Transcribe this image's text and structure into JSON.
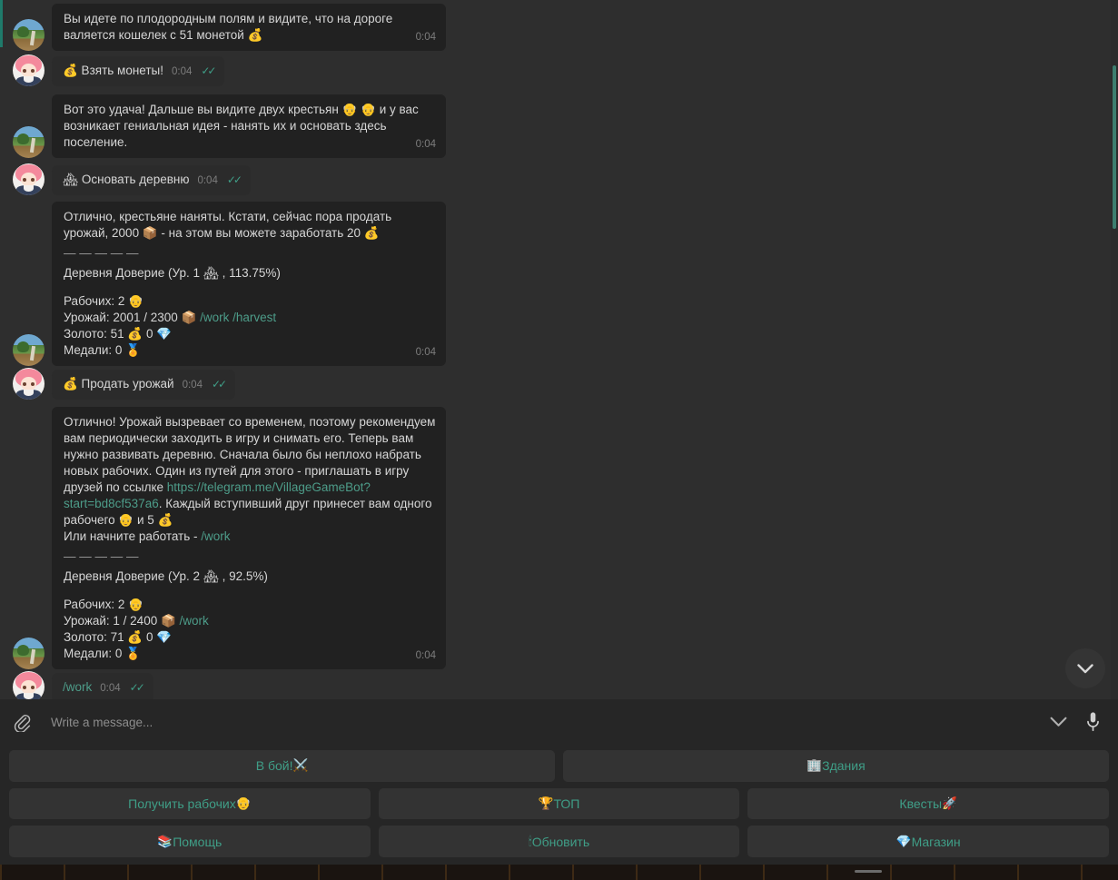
{
  "app": {
    "background_color": "#2e2e2e",
    "accent_color": "#3f9e87",
    "bubble_in_color": "#212121",
    "bubble_out_color": "#2b2b2b"
  },
  "messages": [
    {
      "id": "m1",
      "direction": "in",
      "text": "Вы идете по плодородным полям и видите, что на дороге валяется кошелек с 51 монетой 💰",
      "time": "0:04"
    },
    {
      "id": "m2",
      "direction": "out",
      "text": "💰 Взять монеты!",
      "time": "0:04",
      "status": "read"
    },
    {
      "id": "m3",
      "direction": "in",
      "text": "Вот это удача! Дальше вы видите двух крестьян 👴 👴 и у вас возникает гениальная идея - нанять их и основать здесь поселение.",
      "time": "0:04"
    },
    {
      "id": "m4",
      "direction": "out",
      "text": "🏘 Основать деревню",
      "time": "0:04",
      "status": "read"
    },
    {
      "id": "m5",
      "direction": "in",
      "time": "0:04",
      "intro": "Отлично, крестьяне наняты. Кстати, сейчас пора продать урожай, 2000  📦 - на этом вы можете заработать 20  💰",
      "separator": "—  —  —  —  —",
      "village_line": "Деревня Доверие  (Ур. 1 🏘 , 113.75%)",
      "stats": [
        {
          "label": "Рабочих: 2 ",
          "emoji": "👴",
          "links": ""
        },
        {
          "label": "Урожай: 2001 / 2300 ",
          "emoji": "📦",
          "links": "/work /harvest"
        },
        {
          "label": "Золото: 51 ",
          "emoji": "💰 0 💎",
          "links": ""
        },
        {
          "label": "Медали: 0 ",
          "emoji": "🏅",
          "links": ""
        }
      ]
    },
    {
      "id": "m6",
      "direction": "out",
      "text": "💰 Продать урожай",
      "time": "0:04",
      "status": "read"
    },
    {
      "id": "m7",
      "direction": "in",
      "time": "0:04",
      "intro_a": "Отлично! Урожай вызревает со временем, поэтому рекомендуем вам периодически заходить в игру и снимать его. Теперь вам нужно развивать деревню. Сначала было бы неплохо набрать новых рабочих. Один из путей для этого - приглашать в игру друзей по ссылке ",
      "invite_link": "https://telegram.me/VillageGameBot?start=bd8cf537a6",
      "intro_b": ". Каждый вступивший друг принесет вам одного рабочего 👴 и 5  💰",
      "work_prefix": "Или начните работать - ",
      "work_link": "/work",
      "separator": "—  —  —  —  —",
      "village_line": "Деревня Доверие  (Ур. 2 🏘 , 92.5%)",
      "stats": [
        {
          "label": "Рабочих: 2 ",
          "emoji": "👴",
          "links": ""
        },
        {
          "label": "Урожай: 1 / 2400 ",
          "emoji": "📦",
          "links": "/work"
        },
        {
          "label": "Золото: 71 ",
          "emoji": "💰 0 💎",
          "links": ""
        },
        {
          "label": "Медали: 0 ",
          "emoji": "🏅",
          "links": ""
        }
      ]
    },
    {
      "id": "m8",
      "direction": "out",
      "text": "/work",
      "time": "0:04",
      "status": "read",
      "is_command": true
    }
  ],
  "composer": {
    "placeholder": "Write a message...",
    "value": "",
    "attach_icon": "paperclip-icon",
    "emoji_toggle_icon": "chevron-down-icon",
    "voice_icon": "microphone-icon"
  },
  "scroll_to_bottom": {
    "icon": "chevron-down-icon"
  },
  "keyboard": {
    "rows": [
      [
        {
          "label": "В бой!",
          "emoji": "⚔️",
          "emoji_after": true
        },
        {
          "label": "Здания",
          "emoji": "🏢",
          "emoji_after": false
        }
      ],
      [
        {
          "label": "Получить рабочих",
          "emoji": "👴",
          "emoji_after": true
        },
        {
          "label": "ТОП",
          "emoji": "🏆",
          "emoji_after": false
        },
        {
          "label": "Квесты",
          "emoji": "🚀",
          "emoji_after": true
        }
      ],
      [
        {
          "label": "Помощь",
          "emoji": "📚",
          "emoji_after": false
        },
        {
          "label": "Обновить",
          "emoji": "🕯",
          "emoji_after": false
        },
        {
          "label": "Магазин",
          "emoji": "💎",
          "emoji_after": false
        }
      ]
    ]
  }
}
